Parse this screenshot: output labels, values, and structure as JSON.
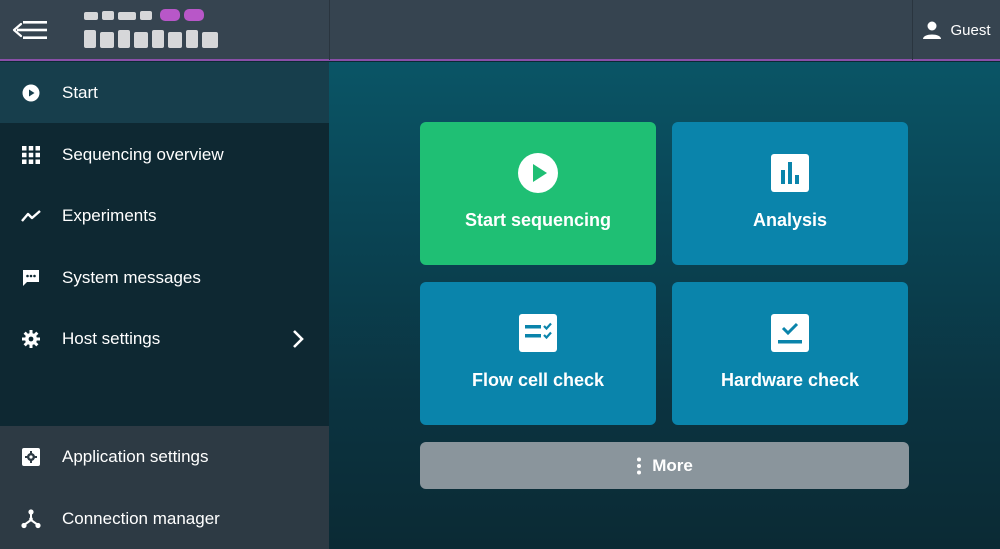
{
  "header": {
    "user_label": "Guest",
    "accent_color": "#8a4fa8"
  },
  "sidebar": {
    "items": [
      {
        "label": "Start",
        "icon": "play-circle-icon"
      },
      {
        "label": "Sequencing overview",
        "icon": "grid-icon"
      },
      {
        "label": "Experiments",
        "icon": "trending-line-icon"
      },
      {
        "label": "System messages",
        "icon": "message-icon"
      },
      {
        "label": "Host settings",
        "icon": "gear-icon"
      }
    ],
    "bottom_items": [
      {
        "label": "Application settings",
        "icon": "settings-box-icon"
      },
      {
        "label": "Connection manager",
        "icon": "network-icon"
      }
    ]
  },
  "tiles": [
    {
      "label": "Start sequencing",
      "icon": "play-circle-icon",
      "color": "#1fbf74"
    },
    {
      "label": "Analysis",
      "icon": "bar-chart-icon",
      "color": "#0a84ab"
    },
    {
      "label": "Flow cell check",
      "icon": "checklist-icon",
      "color": "#0a84ab"
    },
    {
      "label": "Hardware check",
      "icon": "check-box-icon",
      "color": "#0a84ab"
    }
  ],
  "more_label": "More"
}
